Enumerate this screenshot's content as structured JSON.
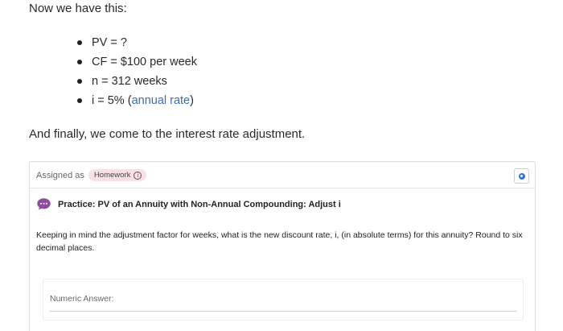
{
  "intro_text": "Now we have this:",
  "variables": [
    {
      "text": "PV = ?"
    },
    {
      "text": "CF = $100 per week"
    },
    {
      "text": "n = 312 weeks"
    },
    {
      "prefix": "i = 5% (",
      "link": "annual rate",
      "suffix": ")"
    }
  ],
  "finally_text": "And finally, we come to the interest rate adjustment.",
  "card": {
    "assigned_label": "Assigned as",
    "badge_label": "Homework",
    "badge_info_glyph": "i",
    "practice_title": "Practice: PV of an Annuity with Non-Annual Compounding: Adjust i",
    "question": "Keeping in mind the adjustment factor for weeks, what is the new discount rate, i, (in absolute terms) for this annuity? Round to six decimal places.",
    "answer_placeholder": "Numeric Answer:"
  },
  "colors": {
    "link": "#3a6db5",
    "badge_bg": "#f7e1e3",
    "chat_icon": "#8e4c9c",
    "corner_icon": "#3b6fd6"
  }
}
